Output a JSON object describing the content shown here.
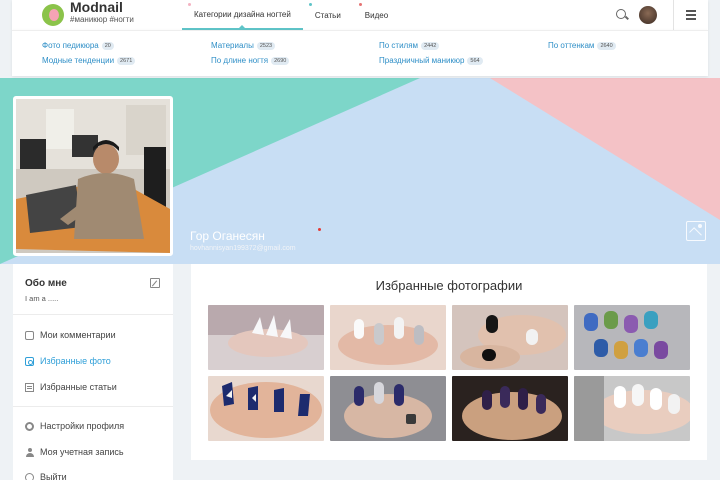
{
  "header": {
    "logo_title": "Modnail",
    "logo_tagline": "#маникюр #ногти",
    "nav": [
      {
        "label": "Категории дизайна ногтей",
        "active": true,
        "dot_color": "#f4b2c2"
      },
      {
        "label": "Статьи",
        "active": false,
        "dot_color": "#5fc4c8"
      },
      {
        "label": "Видео",
        "active": false,
        "dot_color": "#e57373"
      }
    ]
  },
  "categories": [
    {
      "label": "Фото педикюра",
      "count": "20"
    },
    {
      "label": "Модные тенденции",
      "count": "2671"
    },
    {
      "label": "Материалы",
      "count": "2523"
    },
    {
      "label": "По длине ногтя",
      "count": "2690"
    },
    {
      "label": "По стилям",
      "count": "2442"
    },
    {
      "label": "Праздничный маникюр",
      "count": "564"
    },
    {
      "label": "По оттенкам",
      "count": "2640"
    }
  ],
  "profile": {
    "name": "Гор Оганесян",
    "email": "hovhannisyan199372@gmail.com"
  },
  "sidebar": {
    "about_title": "Обо мне",
    "about_text": "I am a .....",
    "menu": [
      {
        "label": "Мои комментарии",
        "icon": "comment-icon",
        "active": false
      },
      {
        "label": "Избранные фото",
        "icon": "photo-icon",
        "active": true
      },
      {
        "label": "Избранные статьи",
        "icon": "article-icon",
        "active": false
      },
      {
        "label": "Настройки профиля",
        "icon": "gear-icon",
        "active": false
      },
      {
        "label": "Моя учетная запись",
        "icon": "user-icon",
        "active": false
      },
      {
        "label": "Выйти",
        "icon": "exit-icon",
        "active": false
      }
    ]
  },
  "favorites": {
    "title": "Избранные фотографии",
    "photos": [
      {
        "name": "white-stiletto-nails-photo"
      },
      {
        "name": "white-silver-nails-photo"
      },
      {
        "name": "black-white-nails-photo"
      },
      {
        "name": "blue-pattern-nails-photo"
      },
      {
        "name": "navy-geometric-nails-photo"
      },
      {
        "name": "silver-ring-nails-photo"
      },
      {
        "name": "dark-purple-nails-photo"
      },
      {
        "name": "white-glitter-nails-photo"
      }
    ]
  },
  "colors": {
    "teal": "#7dd6c9",
    "light_blue": "#c8def4",
    "pink": "#f4c2c6",
    "link_blue": "#2f8fc7",
    "accent": "#5fc4c8"
  }
}
